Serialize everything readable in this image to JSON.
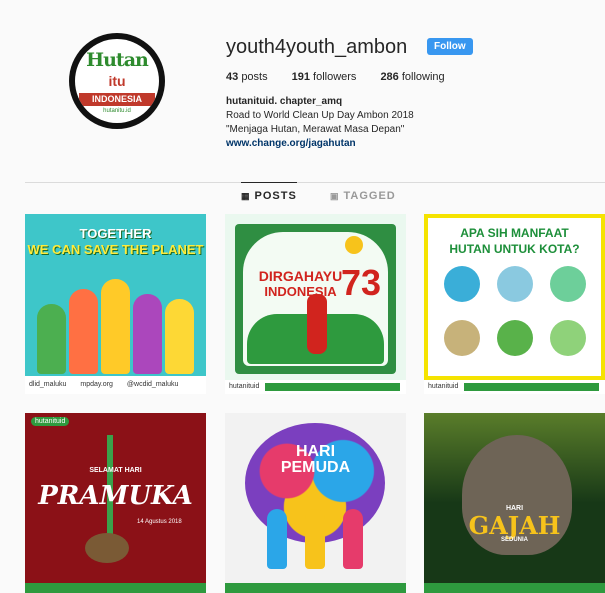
{
  "profile": {
    "username": "youth4youth_ambon",
    "follow_label": "Follow",
    "posts": "43",
    "posts_label": "posts",
    "followers": "191",
    "followers_label": "followers",
    "following": "286",
    "following_label": "following",
    "bio_name": "hutanituid. chapter_amq",
    "bio_line1": "Road to World Clean Up Day Ambon 2018",
    "bio_line2": "\"Menjaga Hutan, Merawat Masa Depan\"",
    "bio_link": "www.change.org/jagahutan",
    "avatar": {
      "line1": "Hutan",
      "line2": "itu",
      "line3": "INDONESIA",
      "line4": "hutanitu.id"
    }
  },
  "tabs": [
    {
      "label": "POSTS",
      "icon": "grid-icon"
    },
    {
      "label": "TAGGED",
      "icon": "tag-icon"
    }
  ],
  "posts": [
    {
      "cap1": "TOGETHER",
      "cap2": "WE CAN SAVE THE PLANET",
      "foot1": "dlid_maluku",
      "foot2": "mpday.org",
      "foot3": "@wcdid_maluku"
    },
    {
      "cap1": "DIRGAHAYU",
      "cap2": "INDONESIA",
      "num": "73",
      "foot": "hutanituid"
    },
    {
      "cap1": "APA SIH MANFAAT",
      "cap2": "HUTAN UNTUK KOTA?",
      "foot": "hutanituid"
    },
    {
      "tag": "hutanituid",
      "cap1": "SELAMAT HARI",
      "cap2": "PRAMUKA",
      "date": "14 Agustus 2018"
    },
    {
      "cap1": "HARI",
      "cap2": "PEMUDA"
    },
    {
      "cap1": "HARI",
      "cap2": "GAJAH",
      "cap3": "SEDUNIA"
    }
  ],
  "colors": {
    "follow_blue": "#3897f0",
    "link_blue": "#003569",
    "accent_green": "#2e9a3e",
    "accent_red": "#d1241e"
  }
}
